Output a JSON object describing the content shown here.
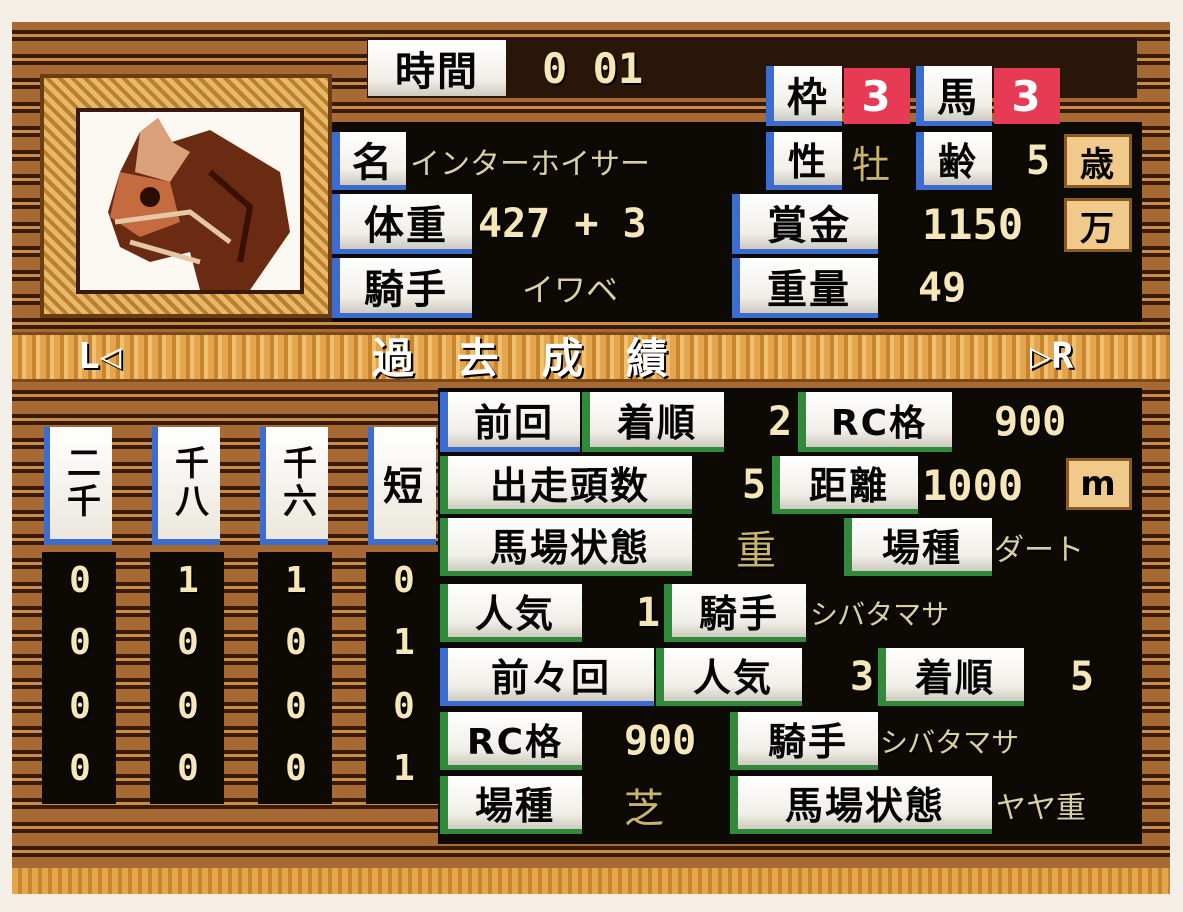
{
  "header": {
    "time_label": "時間",
    "time_value": "0 01",
    "frame_label": "枠",
    "frame_value": "3",
    "horse_label": "馬",
    "horse_value": "3"
  },
  "horse": {
    "name_label": "名",
    "name": "インターホイサー",
    "sex_label": "性",
    "sex": "牡",
    "age_label": "齢",
    "age": "5",
    "age_unit": "歳",
    "weight_label": "体重",
    "weight": "427 + 3",
    "prize_label": "賞金",
    "prize": "1150",
    "prize_unit": "万",
    "jockey_label": "騎手",
    "jockey": "イワベ",
    "burden_label": "重量",
    "burden": "49"
  },
  "past_results": {
    "title": "過 去 成 績",
    "prev_key": "L◁",
    "next_key": "▷R",
    "columns": [
      "二千",
      "千八",
      "千六",
      "短"
    ],
    "rows": [
      [
        "0",
        "1",
        "1",
        "0"
      ],
      [
        "0",
        "0",
        "0",
        "1"
      ],
      [
        "0",
        "0",
        "0",
        "0"
      ],
      [
        "0",
        "0",
        "0",
        "1"
      ]
    ]
  },
  "last_race": {
    "last_label": "前回",
    "finish_label": "着順",
    "finish": "2",
    "rc_label": "RC格",
    "rc": "900",
    "runners_label": "出走頭数",
    "runners": "5",
    "distance_label": "距離",
    "distance": "1000",
    "distance_unit": "m",
    "going_label": "馬場状態",
    "going": "重",
    "surface_label": "場種",
    "surface": "ダート",
    "popularity_label": "人気",
    "popularity": "1",
    "jockey_label": "騎手",
    "jockey": "シバタマサ"
  },
  "race_before": {
    "label": "前々回",
    "popularity_label": "人気",
    "popularity": "3",
    "finish_label": "着順",
    "finish": "5",
    "rc_label": "RC格",
    "rc": "900",
    "jockey_label": "騎手",
    "jockey": "シバタマサ",
    "surface_label": "場種",
    "surface": "芝",
    "going_label": "馬場状態",
    "going": "ヤヤ重"
  },
  "colors": {
    "label_bg": "#f1efe8",
    "accent_blue": "#3b6ccf",
    "accent_green": "#2f8a3a",
    "accent_red": "#e63a55",
    "value_text": "#f5e7b8",
    "wood": "#a86a34"
  }
}
